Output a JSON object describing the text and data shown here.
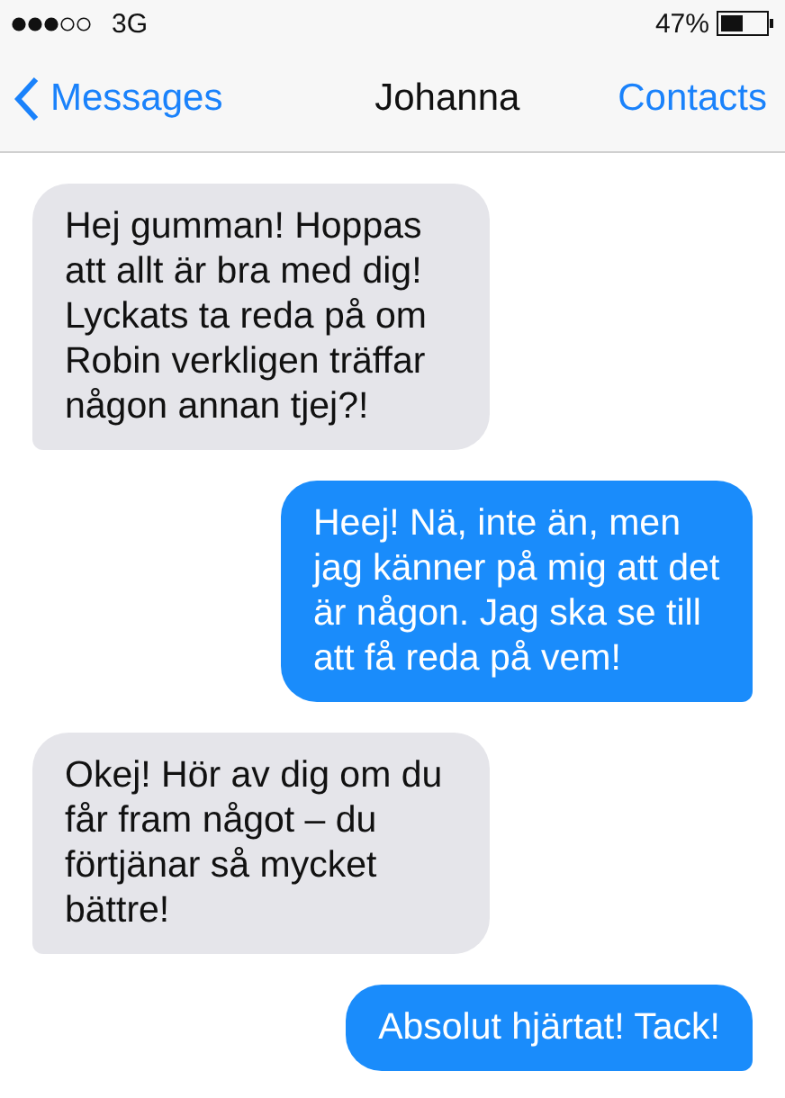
{
  "status_bar": {
    "carrier": "3G",
    "battery": "47%"
  },
  "nav_bar": {
    "back": "Messages",
    "title": "Johanna",
    "action": "Contacts"
  },
  "messages": [
    {
      "kind": "received",
      "text": "Hej gumman! Hoppas att allt är bra med dig! Lyckats ta reda på om Robin verkligen träffar någon annan tjej?!"
    },
    {
      "kind": "sent",
      "text": "Heej! Nä, inte än, men jag känner på mig att det är någon. Jag ska se till att få reda på vem!"
    },
    {
      "kind": "received",
      "text": "Okej! Hör av dig om du får fram något – du förtjänar så mycket bättre!"
    },
    {
      "kind": "sent",
      "text": "Absolut hjärtat! Tack!"
    }
  ]
}
